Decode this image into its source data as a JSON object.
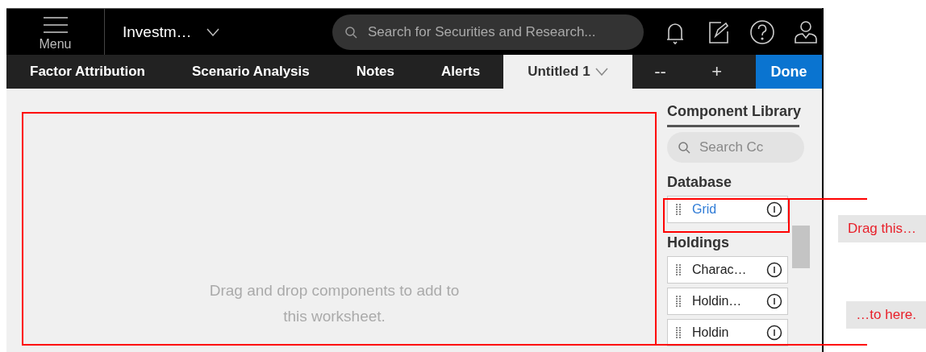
{
  "header": {
    "menu_label": "Menu",
    "workspace": "Investm…",
    "search": {
      "placeholder": "Search for Securities and Research..."
    }
  },
  "tabs": [
    {
      "label": "Factor Attribution",
      "selected": false
    },
    {
      "label": "Scenario Analysis",
      "selected": false
    },
    {
      "label": "Notes",
      "selected": false
    },
    {
      "label": "Alerts",
      "selected": false
    },
    {
      "label": "Untitled 1",
      "selected": true
    }
  ],
  "tab_actions": [
    "--",
    "+"
  ],
  "done": "Done",
  "canvas": {
    "message": "Drag and drop components to add to this worksheet."
  },
  "library": {
    "title": "Component Library",
    "search": {
      "placeholder": "Search Cc"
    },
    "sections": [
      {
        "title": "Database",
        "items": [
          {
            "label": "Grid",
            "highlighted": true
          }
        ]
      },
      {
        "title": "Holdings",
        "items": [
          {
            "label": "Charac…",
            "highlighted": false
          },
          {
            "label": "Holdin…",
            "highlighted": false
          },
          {
            "label": "Holdin",
            "highlighted": false
          }
        ]
      }
    ]
  },
  "callouts": [
    "Drag this…",
    "…to here."
  ]
}
